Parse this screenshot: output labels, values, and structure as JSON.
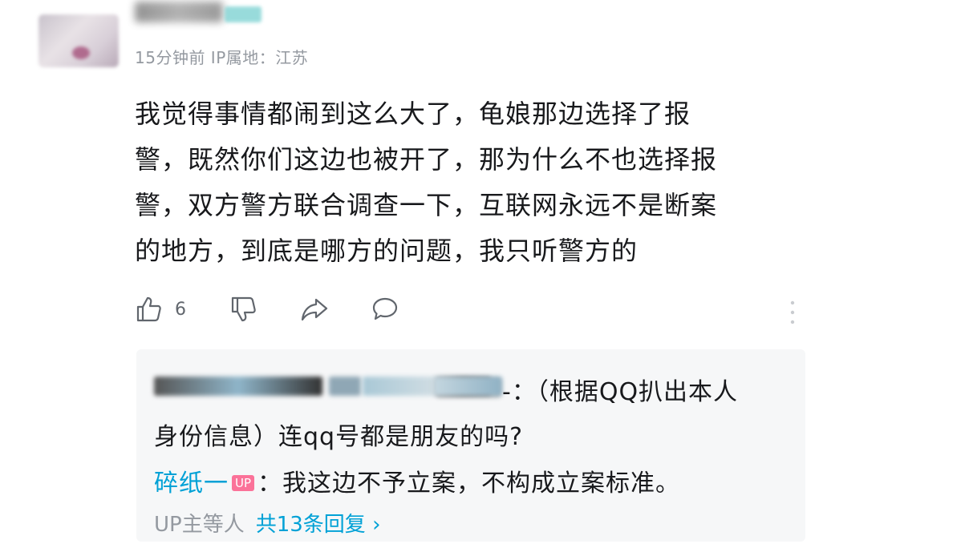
{
  "comment": {
    "meta": "15分钟前 IP属地：江苏",
    "lines": [
      "我觉得事情都闹到这么大了，龟娘那边选择了报",
      "警，既然你们这边也被开了，那为什么不也选择报",
      "警，双方警方联合调查一下，互联网永远不是断案",
      "的地方，到底是哪方的问题，我只听警方的"
    ],
    "like_count": "6"
  },
  "replies": {
    "reply1_line1_tail": "-：（根据QQ扒出本人",
    "reply1_line2": "身份信息）连qq号都是朋友的吗?",
    "reply2_user": "碎纸一",
    "reply2_badge": "UP",
    "reply2_text": "：我这边不予立案，不构成立案标准。",
    "summary_prefix": "UP主等人",
    "summary_count": "共13条回复 ›"
  },
  "colors": {
    "link": "#00a1d6",
    "up_badge": "#fb7299",
    "meta_gray": "#9499a0",
    "reply_bg": "#f6f7f8"
  }
}
